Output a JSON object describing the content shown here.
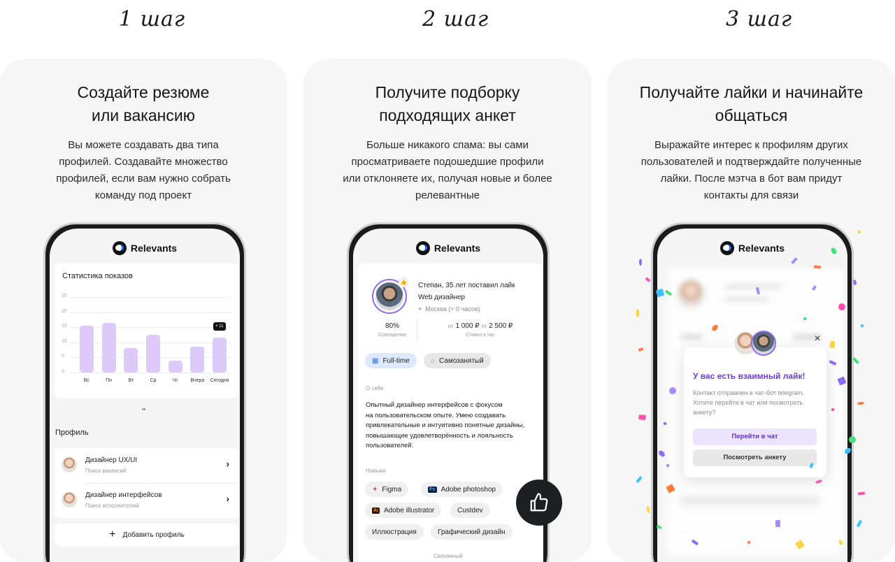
{
  "steps": [
    {
      "label": "1 шаг",
      "title": "Создайте резюме\nили вакансию",
      "description": "Вы можете создавать два типа\nпрофилей. Создавайте множество\nпрофилей, если вам нужно собрать\nкоманду под проект"
    },
    {
      "label": "2 шаг",
      "title": "Получите подборку\nподходящих анкет",
      "description": "Больше никакого спама: вы сами\nпросматриваете подошедшие профили\nили отклоняете их, получая новые и более\nрелевантные"
    },
    {
      "label": "3 шаг",
      "title": "Получайте лайки и начинайте\nобщаться",
      "description": "Выражайте интерес к профилям других\nпользователей и подтверждайте полученные\nлайки. После мэтча в бот вам придут\nконтакты для связи"
    }
  ],
  "brand": "Relevants",
  "phone1": {
    "stats_title": "Статистика показов",
    "y_ticks": [
      "25",
      "20",
      "15",
      "10",
      "5",
      "0"
    ],
    "chart_data": {
      "type": "bar",
      "categories": [
        "Вс",
        "Пн",
        "Вт",
        "Ср",
        "Чт",
        "Вчера",
        "Сегодня"
      ],
      "values": [
        15.5,
        16.5,
        8,
        12.5,
        4,
        8.5,
        11.5
      ],
      "ylim": [
        0,
        25
      ],
      "annotation": "+ 11"
    },
    "profile_heading": "Профиль",
    "profiles": [
      {
        "title": "Дизайнер UX/UI",
        "subtitle": "Поиск вакансий"
      },
      {
        "title": "Дизайнер интерфейсов",
        "subtitle": "Поиск исполнителей"
      }
    ],
    "add_profile": "Добавить профиль"
  },
  "phone2": {
    "liked_line": "Степан, 35 лет поставил лайк",
    "role": "Web дизайнер",
    "location": "Москва (+ 0 часов)",
    "match_value": "80%",
    "match_label": "Совпадение",
    "rate_value_prefix_from": "от",
    "rate_from": "1 000 ₽",
    "rate_value_prefix_to": "от",
    "rate_to": "2 500 ₽",
    "rate_label": "Ставка в час",
    "tags": [
      "Full-time",
      "Самозанятый"
    ],
    "about_heading": "О себе",
    "about_text": "Опытный дизайнер интерфейсов с фокусом\nна пользовательском опыте. Умею создавать\nпривлекательные и интуитивно понятные дизайны,\nповышающие удовлетворённость и лояльность\nпользователей.",
    "skills_heading": "Навыки",
    "skills": [
      "Figma",
      "Adobe photoshop",
      "Adobe illustrator",
      "Custdev",
      "Иллюстрация",
      "Графический дизайн"
    ],
    "more_heading": "Связанный"
  },
  "phone3": {
    "modal_title": "У вас есть взаимный лайк!",
    "modal_text": "Контакт отправлен в чат-бот telegram.\nХотите перейти в чат или посмотреть\nанкету?",
    "btn_chat": "Перейти в чат",
    "btn_profile": "Посмотреть анкету"
  },
  "colors": {
    "accent": "#6b3fd4",
    "bar": "#dccbf9",
    "card_bg": "#f6f6f6"
  }
}
